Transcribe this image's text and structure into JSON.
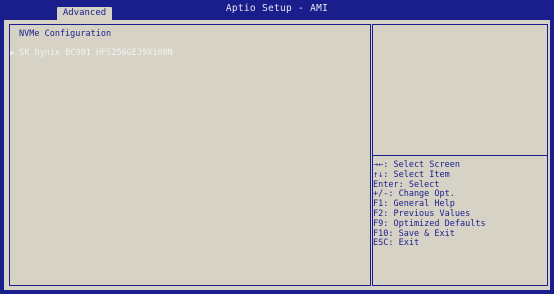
{
  "header": {
    "title": "Aptio Setup - AMI",
    "tab_label": "Advanced"
  },
  "main": {
    "section_title": "NVMe Configuration",
    "devices": [
      {
        "arrow": "▶",
        "label": "SK hynix BC901 HFS256GEJ9X108N"
      }
    ]
  },
  "help_keys": [
    "→←: Select Screen",
    "↑↓: Select Item",
    "Enter: Select",
    "+/-: Change Opt.",
    "F1: General Help",
    "F2: Previous Values",
    "F9: Optimized Defaults",
    "F10: Save & Exit",
    "ESC: Exit"
  ],
  "colors": {
    "frame_blue": "#1a1e8c",
    "panel_gray": "#d6d2c6",
    "highlight_white": "#f2f2f2"
  }
}
